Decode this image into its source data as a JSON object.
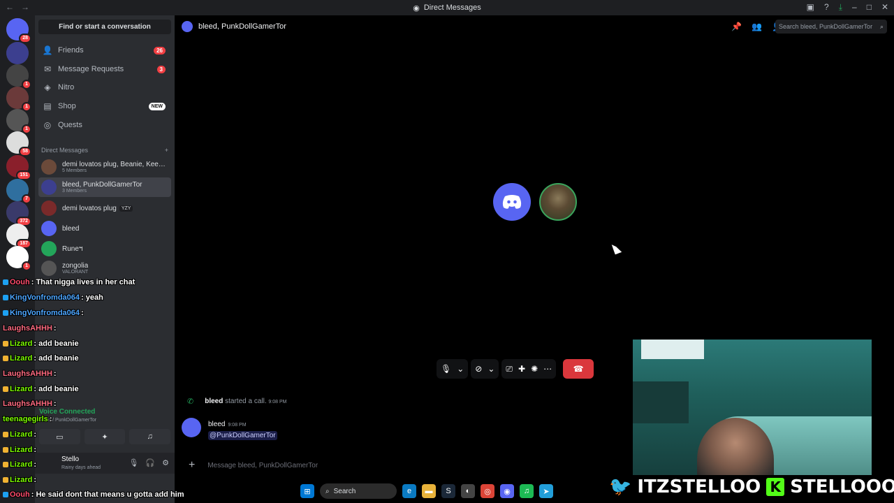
{
  "titlebar": {
    "title": "Direct Messages"
  },
  "sidebar": {
    "find_label": "Find or start a conversation",
    "nav": [
      {
        "label": "Friends",
        "count": "26"
      },
      {
        "label": "Message Requests",
        "count": "3"
      },
      {
        "label": "Nitro"
      },
      {
        "label": "Shop",
        "badge": "NEW"
      },
      {
        "label": "Quests"
      }
    ],
    "dm_header": "Direct Messages",
    "dms": [
      {
        "name": "demi lovatos plug, Beanie, Keep...",
        "sub": "5 Members"
      },
      {
        "name": "bleed, PunkDollGamerTor",
        "sub": "3 Members"
      },
      {
        "name": "demi lovatos plug",
        "tag": "YZY"
      },
      {
        "name": "bleed"
      },
      {
        "name": "Runeฯ"
      },
      {
        "name": "zongolia",
        "sub": "VALORANT"
      }
    ],
    "voice": {
      "title": "Voice Connected",
      "sub": "bleed / PunkDollGamerTor"
    },
    "user": {
      "name": "Stello",
      "status": "Rainy days ahead"
    }
  },
  "rail_badges": [
    "28",
    "1",
    "1",
    "1",
    "1",
    "58",
    "151",
    "7",
    "372",
    "187",
    "1"
  ],
  "main": {
    "header_title": "bleed, PunkDollGamerTor",
    "search_placeholder": "Search bleed, PunkDollGamerTor",
    "system_msg": {
      "user": "bleed",
      "text": "started a call.",
      "time": "9:08 PM"
    },
    "message": {
      "user": "bleed",
      "time": "9:08 PM",
      "mention": "@PunkDollGamerTor"
    },
    "composer_placeholder": "Message bleed, PunkDollGamerTor"
  },
  "overlay_chat": [
    {
      "name": "Oouh",
      "text": ": That nigga lives in her chat",
      "color": "#ff4d6d"
    },
    {
      "name": "KingVonfromda064",
      "text": ": yeah",
      "color": "#4da6ff"
    },
    {
      "name": "KingVonfromda064",
      "text": ":",
      "color": "#4da6ff"
    },
    {
      "name": "LaughsAHHH",
      "text": ":",
      "color": "#ff6b81"
    },
    {
      "name": "Lizard",
      "text": ": add beanie",
      "color": "#7cfc00"
    },
    {
      "name": "Lizard",
      "text": ": add beanie",
      "color": "#7cfc00"
    },
    {
      "name": "LaughsAHHH",
      "text": ":",
      "color": "#ff6b81"
    },
    {
      "name": "Lizard",
      "text": ": add beanie",
      "color": "#7cfc00"
    },
    {
      "name": "LaughsAHHH",
      "text": ":",
      "color": "#ff6b81"
    },
    {
      "name": "teenagegirls",
      "text": ":",
      "color": "#7cfc00"
    },
    {
      "name": "Lizard",
      "text": ":",
      "color": "#7cfc00"
    },
    {
      "name": "Lizard",
      "text": ":",
      "color": "#7cfc00"
    },
    {
      "name": "Lizard",
      "text": ":",
      "color": "#7cfc00"
    },
    {
      "name": "Lizard",
      "text": ":",
      "color": "#7cfc00"
    },
    {
      "name": "Oouh",
      "text": ": He said dont that means u gotta add him",
      "color": "#ff4d6d"
    }
  ],
  "banner": {
    "twitter": "ITZSTELLOO",
    "kick": "STELLOOO"
  },
  "taskbar": {
    "search_label": "Search"
  }
}
